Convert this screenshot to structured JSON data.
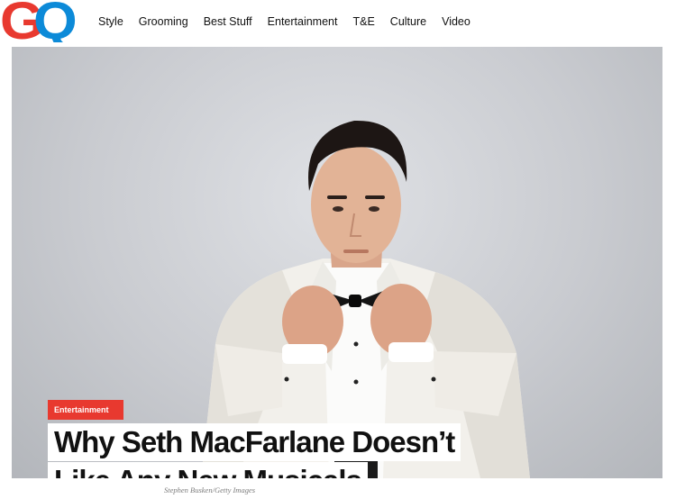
{
  "logo": {
    "letter_1": "G",
    "letter_2": "Q"
  },
  "nav": {
    "items": [
      "Style",
      "Grooming",
      "Best Stuff",
      "Entertainment",
      "T&E",
      "Culture",
      "Video"
    ]
  },
  "hero": {
    "category": "Entertainment",
    "headline_line_1": "Why Seth MacFarlane Doesn’t",
    "headline_line_2": "Like Any New Musicals",
    "photo_credit": "Stephen Busken/Getty Images"
  },
  "colors": {
    "brand_red": "#e8392f",
    "brand_blue": "#0c8ad8"
  }
}
